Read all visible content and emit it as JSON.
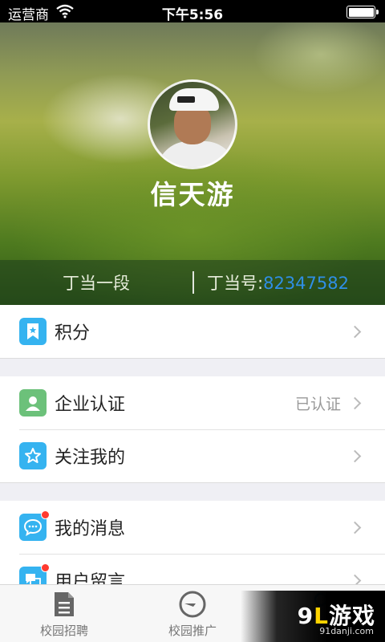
{
  "status_bar": {
    "carrier": "运营商",
    "time": "下午5:56",
    "battery_level": 1.0
  },
  "profile": {
    "username": "信天游",
    "rank": "丁当一段",
    "id_label": "丁当号:",
    "id_number": "82347582"
  },
  "menu": {
    "points": {
      "label": "积分",
      "icon": "bookmark-icon",
      "color": "#35b3f0"
    },
    "company_verify": {
      "label": "企业认证",
      "value": "已认证",
      "icon": "person-icon",
      "color": "#6cc17a"
    },
    "following_me": {
      "label": "关注我的",
      "icon": "star-icon",
      "color": "#35b3f0"
    },
    "my_messages": {
      "label": "我的消息",
      "icon": "chat-bubble-icon",
      "color": "#35b3f0",
      "badge_color": "#ff3b30"
    },
    "user_comments": {
      "label": "用户留言",
      "icon": "chat-bubbles-icon",
      "color": "#35b3f0",
      "badge_color": "#ff3b30"
    }
  },
  "tabbar": {
    "tabs": [
      {
        "label": "校园招聘",
        "icon": "document-icon"
      },
      {
        "label": "校园推广",
        "icon": "compass-icon"
      },
      {
        "label": "",
        "icon": "person-icon",
        "active": true
      }
    ],
    "active_color": "#2ea9e6"
  },
  "watermark": {
    "brand_num": "9",
    "brand_hl": "L",
    "brand_text": "游戏",
    "domain": "91danji.com"
  }
}
